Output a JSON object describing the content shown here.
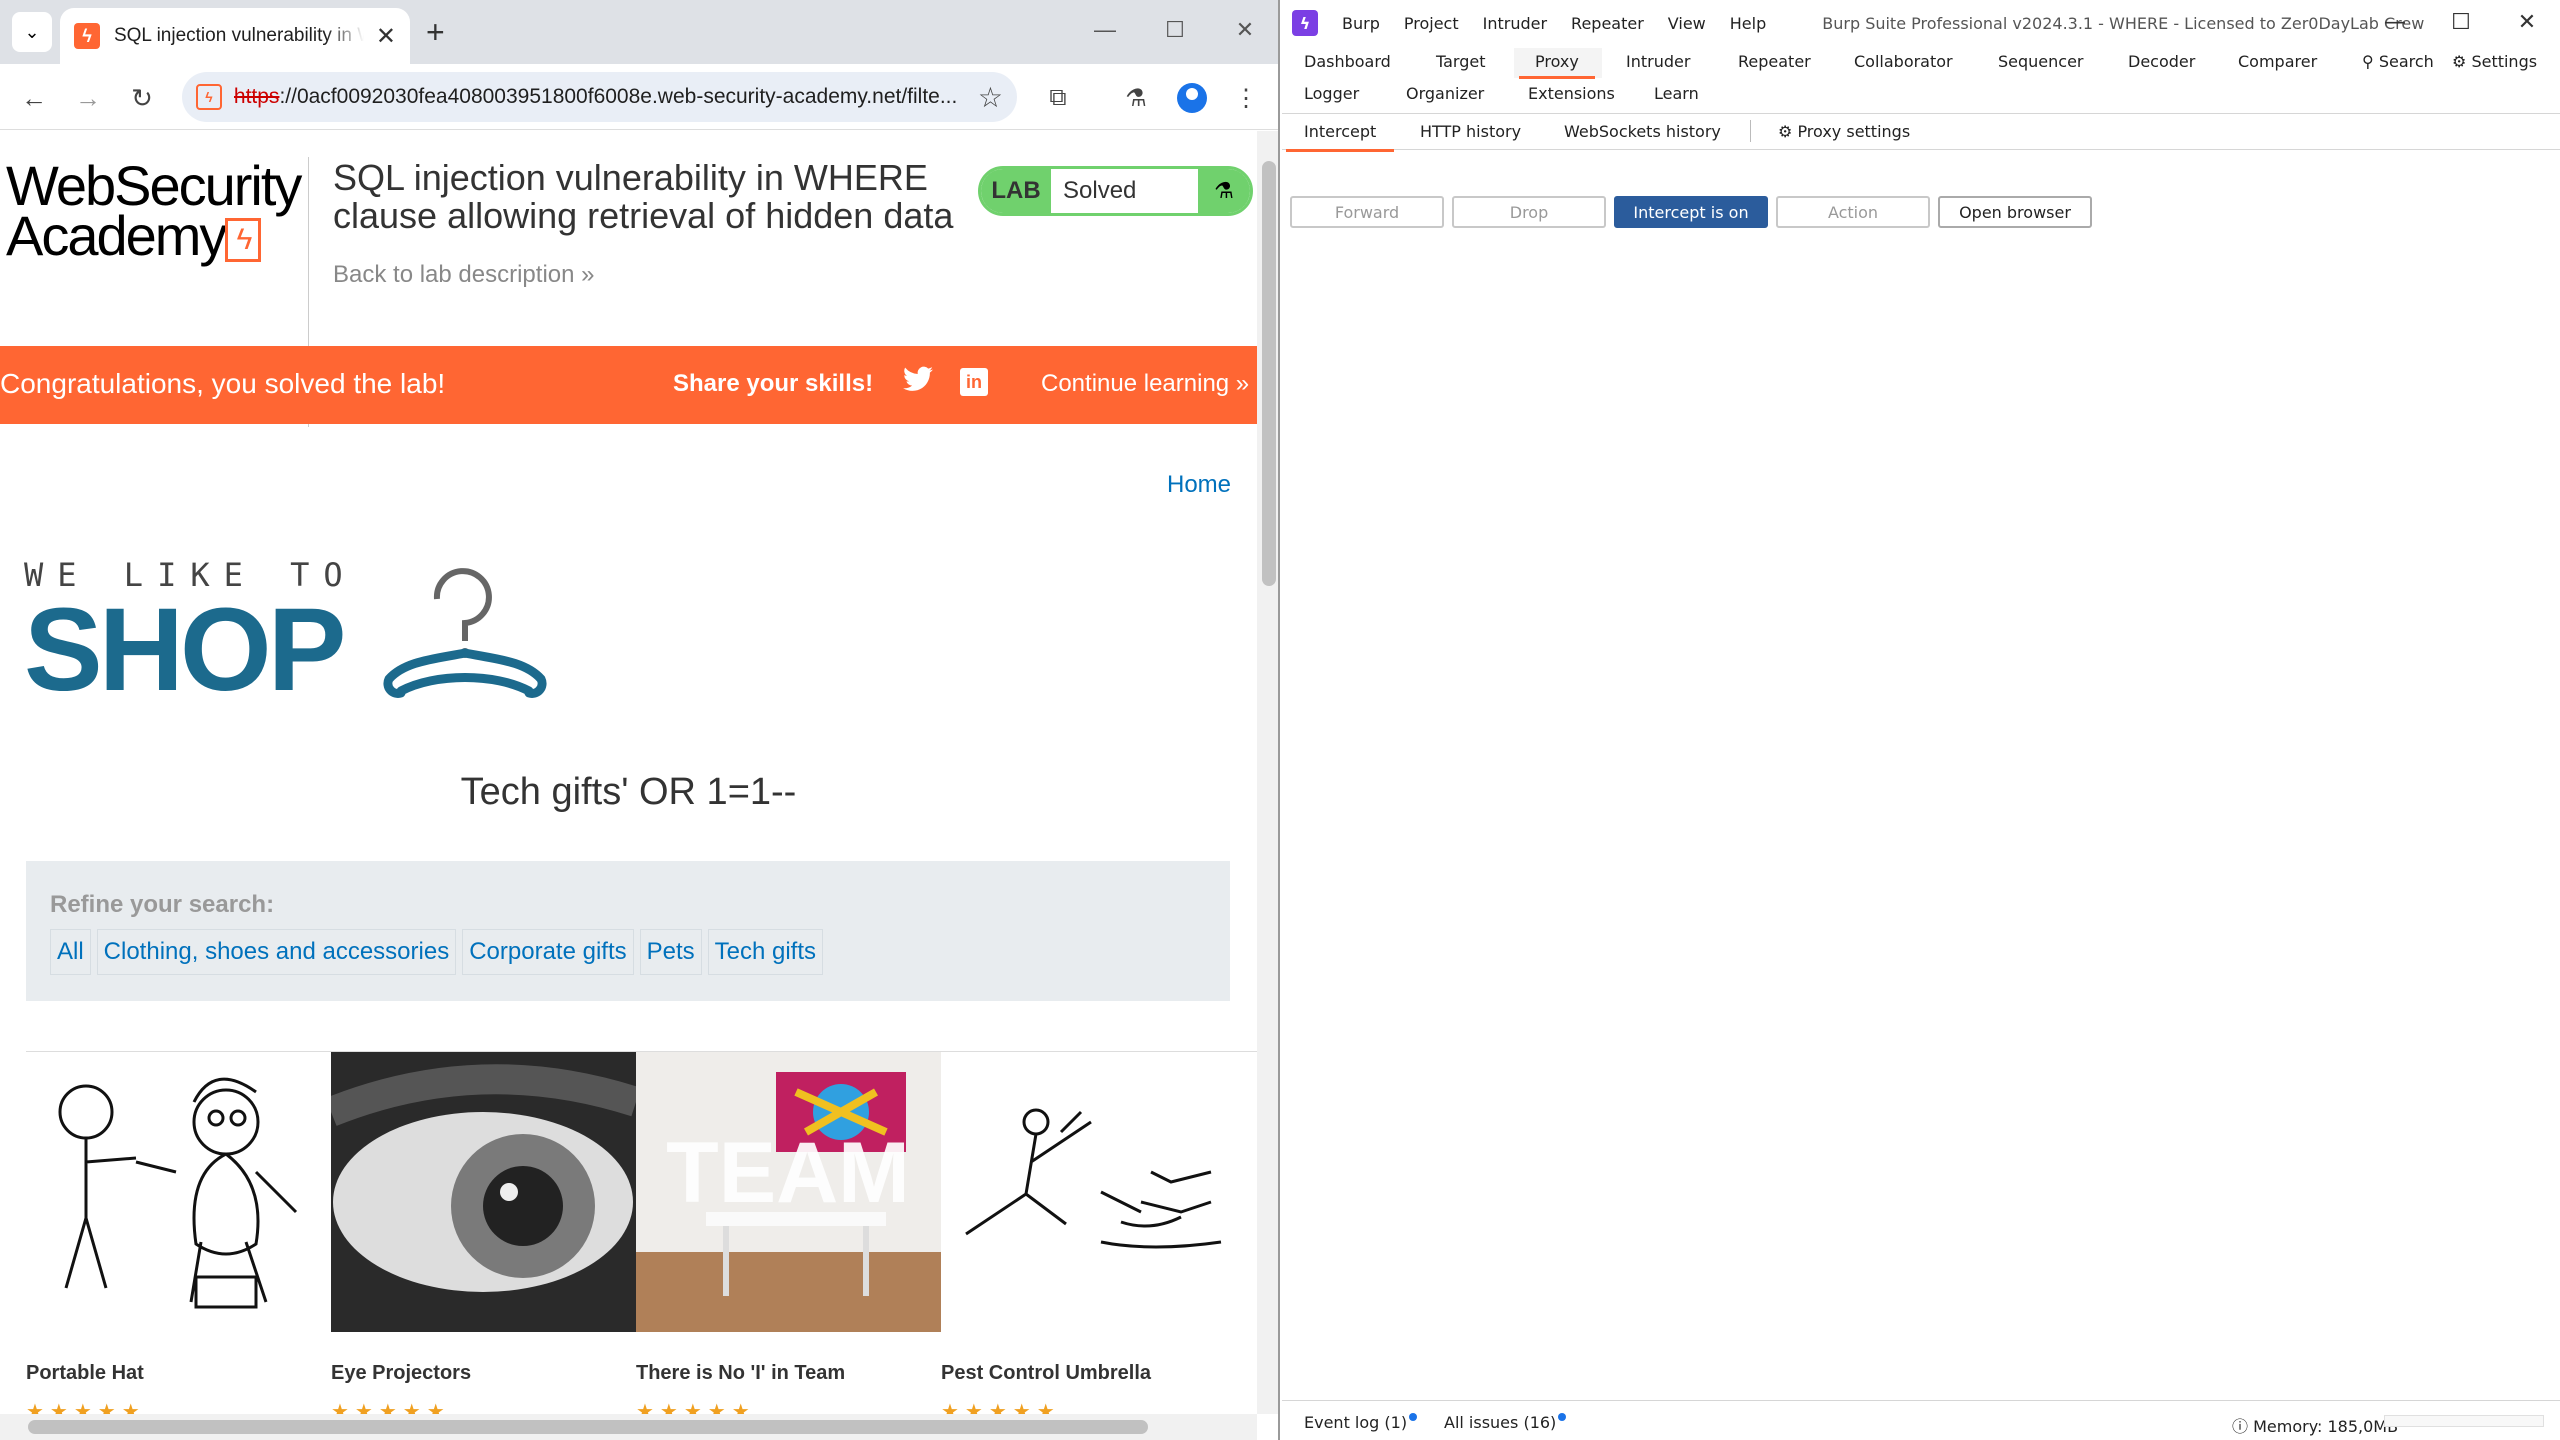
{
  "chrome": {
    "tab": {
      "title": "SQL injection vulnerability in WHERE clause allowing retrieval of hidden data",
      "close": "✕"
    },
    "new_tab": "+",
    "window_buttons": {
      "minimize": "—",
      "maximize": "☐",
      "close": "✕"
    },
    "omnibox": {
      "protocol": "https",
      "url_rest": "://0acf0092030fea408003951800f6008e.web-security-academy.net/filte..."
    }
  },
  "lab": {
    "logo_line1": "WebSecurity",
    "logo_line2": "Academy",
    "title": "SQL injection vulnerability in WHERE clause allowing retrieval of hidden data",
    "back_link": "Back to lab description  »",
    "badge_lab": "LAB",
    "badge_status": "Solved",
    "banner": {
      "congrats": "Congratulations, you solved the lab!",
      "share": "Share your skills!",
      "linkedin": "in",
      "continue": "Continue learning »"
    },
    "home_link": "Home",
    "shop_small": "WE LIKE TO",
    "shop_big": "SHOP",
    "search_term": "Tech gifts' OR 1=1--",
    "refine_title": "Refine your search:",
    "categories": [
      "All",
      "Clothing, shoes and accessories",
      "Corporate gifts",
      "Pets",
      "Tech gifts"
    ],
    "products": [
      {
        "name": "Portable Hat",
        "stars": "★★★★★"
      },
      {
        "name": "Eye Projectors",
        "stars": "★★★★★"
      },
      {
        "name": "There is No 'I' in Team",
        "stars": "★★★★★"
      },
      {
        "name": "Pest Control Umbrella",
        "stars": "★★★★★"
      }
    ]
  },
  "burp": {
    "menu": [
      "Burp",
      "Project",
      "Intruder",
      "Repeater",
      "View",
      "Help"
    ],
    "window_title": "Burp Suite Professional v2024.3.1 - WHERE - Licensed to Zer0DayLab Crew",
    "window_buttons": {
      "minimize": "—",
      "maximize": "☐",
      "close": "✕"
    },
    "tabs_row1": [
      "Dashboard",
      "Target",
      "Proxy",
      "Intruder",
      "Repeater",
      "Collaborator",
      "Sequencer",
      "Decoder",
      "Comparer"
    ],
    "tabs_row2": [
      "Logger",
      "Organizer",
      "Extensions",
      "Learn"
    ],
    "search": "Search",
    "settings": "Settings",
    "proxy_tabs": [
      "Intercept",
      "HTTP history",
      "WebSockets history"
    ],
    "proxy_settings": "Proxy settings",
    "buttons": {
      "forward": "Forward",
      "drop": "Drop",
      "intercept": "Intercept is on",
      "action": "Action",
      "open_browser": "Open browser"
    },
    "status": {
      "event_log": "Event log (1)",
      "all_issues": "All issues (16)",
      "memory": "Memory: 185,0MB"
    }
  },
  "colors": {
    "orange": "#ff6633",
    "lab_green": "#70d16d",
    "link_blue": "#0071bc",
    "shop_blue": "#1c6a8d",
    "intercept_blue": "#2b5c9c"
  }
}
